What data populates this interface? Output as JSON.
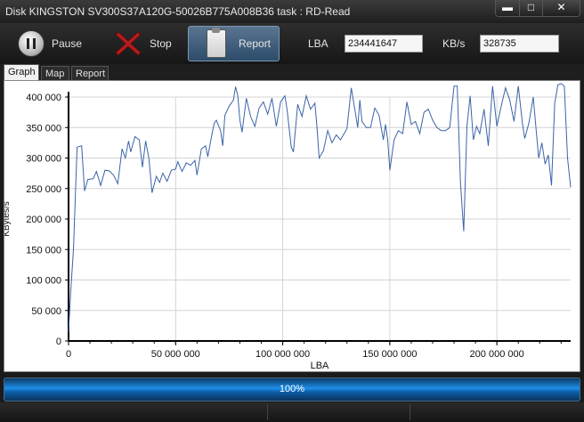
{
  "window": {
    "title": "Disk KINGSTON SV300S37A120G-50026B775A008B36   task : RD-Read",
    "minimize_glyph": "▬",
    "maximize_glyph": "□",
    "close_glyph": "✕"
  },
  "toolbar": {
    "pause_label": "Pause",
    "stop_label": "Stop",
    "report_label": "Report",
    "lba_label": "LBA",
    "lba_value": "234441647",
    "kbs_label": "KB/s",
    "kbs_value": "328735",
    "accent_color": "#3b5f82"
  },
  "tabs": [
    {
      "label": "Graph",
      "active": true
    },
    {
      "label": "Map",
      "active": false
    },
    {
      "label": "Report",
      "active": false
    }
  ],
  "chart_data": {
    "type": "line",
    "title": "",
    "xlabel": "LBA",
    "ylabel": "KBytes/s",
    "xlim": [
      0,
      234441647
    ],
    "ylim": [
      0,
      400000
    ],
    "x_ticks": [
      0,
      50000000,
      100000000,
      150000000,
      200000000
    ],
    "x_tick_labels": [
      "0",
      "50 000 000",
      "100 000 000",
      "150 000 000",
      "200 000 000"
    ],
    "y_ticks": [
      0,
      50000,
      100000,
      150000,
      200000,
      250000,
      300000,
      350000,
      400000
    ],
    "y_tick_labels": [
      "0",
      "50 000",
      "100 000",
      "150 000",
      "200 000",
      "250 000",
      "300 000",
      "350 000",
      "400 000"
    ],
    "grid": true,
    "line_color": "#3b64a8",
    "series": [
      {
        "values": [
          [
            0,
            15000
          ],
          [
            1000000,
            80000
          ],
          [
            2300000,
            150000
          ],
          [
            4000000,
            318000
          ],
          [
            6100000,
            320000
          ],
          [
            7500000,
            246000
          ],
          [
            9000000,
            265000
          ],
          [
            11500000,
            266000
          ],
          [
            13000000,
            278000
          ],
          [
            15000000,
            255000
          ],
          [
            17000000,
            280000
          ],
          [
            19000000,
            279000
          ],
          [
            21000000,
            272000
          ],
          [
            23000000,
            258000
          ],
          [
            25000000,
            315000
          ],
          [
            26500000,
            300000
          ],
          [
            28000000,
            328000
          ],
          [
            29000000,
            310000
          ],
          [
            31000000,
            335000
          ],
          [
            33000000,
            330000
          ],
          [
            34500000,
            285000
          ],
          [
            36000000,
            328000
          ],
          [
            37500000,
            300000
          ],
          [
            39000000,
            243000
          ],
          [
            41000000,
            270000
          ],
          [
            42500000,
            260000
          ],
          [
            44000000,
            275000
          ],
          [
            46000000,
            262000
          ],
          [
            48000000,
            280000
          ],
          [
            50000000,
            282000
          ],
          [
            51000000,
            294000
          ],
          [
            53000000,
            278000
          ],
          [
            55000000,
            292000
          ],
          [
            57000000,
            288000
          ],
          [
            59000000,
            296000
          ],
          [
            60000000,
            272000
          ],
          [
            62000000,
            315000
          ],
          [
            64000000,
            320000
          ],
          [
            65000000,
            302000
          ],
          [
            67000000,
            340000
          ],
          [
            68000000,
            357000
          ],
          [
            69000000,
            362000
          ],
          [
            71000000,
            345000
          ],
          [
            72000000,
            320000
          ],
          [
            73000000,
            370000
          ],
          [
            75000000,
            385000
          ],
          [
            77000000,
            395000
          ],
          [
            78000000,
            417000
          ],
          [
            79000000,
            402000
          ],
          [
            80000000,
            362000
          ],
          [
            81000000,
            342000
          ],
          [
            83000000,
            398000
          ],
          [
            85000000,
            368000
          ],
          [
            87000000,
            352000
          ],
          [
            89000000,
            382000
          ],
          [
            91000000,
            392000
          ],
          [
            93000000,
            372000
          ],
          [
            95000000,
            398000
          ],
          [
            97000000,
            352000
          ],
          [
            99000000,
            392000
          ],
          [
            101000000,
            402000
          ],
          [
            102000000,
            380000
          ],
          [
            104000000,
            318000
          ],
          [
            105000000,
            310000
          ],
          [
            107000000,
            388000
          ],
          [
            109000000,
            368000
          ],
          [
            111000000,
            402000
          ],
          [
            113000000,
            380000
          ],
          [
            115000000,
            390000
          ],
          [
            116000000,
            350000
          ],
          [
            117000000,
            300000
          ],
          [
            119000000,
            312000
          ],
          [
            121000000,
            345000
          ],
          [
            123000000,
            325000
          ],
          [
            125000000,
            338000
          ],
          [
            127000000,
            330000
          ],
          [
            130000000,
            348000
          ],
          [
            132000000,
            415000
          ],
          [
            134000000,
            372000
          ],
          [
            135000000,
            350000
          ],
          [
            136000000,
            395000
          ],
          [
            137000000,
            360000
          ],
          [
            139000000,
            350000
          ],
          [
            141000000,
            350000
          ],
          [
            143000000,
            382000
          ],
          [
            145000000,
            370000
          ],
          [
            147000000,
            330000
          ],
          [
            148000000,
            355000
          ],
          [
            149000000,
            330000
          ],
          [
            150000000,
            280000
          ],
          [
            152000000,
            330000
          ],
          [
            154000000,
            345000
          ],
          [
            156000000,
            340000
          ],
          [
            158000000,
            392000
          ],
          [
            160000000,
            355000
          ],
          [
            162000000,
            360000
          ],
          [
            164000000,
            340000
          ],
          [
            166000000,
            375000
          ],
          [
            168000000,
            380000
          ],
          [
            170000000,
            362000
          ],
          [
            172000000,
            350000
          ],
          [
            174000000,
            345000
          ],
          [
            176000000,
            345000
          ],
          [
            178000000,
            350000
          ],
          [
            180000000,
            418000
          ],
          [
            181500000,
            418000
          ],
          [
            183000000,
            260000
          ],
          [
            184500000,
            180000
          ],
          [
            186000000,
            352000
          ],
          [
            187500000,
            402000
          ],
          [
            189000000,
            330000
          ],
          [
            190500000,
            352000
          ],
          [
            192000000,
            340000
          ],
          [
            194000000,
            380000
          ],
          [
            196000000,
            320000
          ],
          [
            198000000,
            418000
          ],
          [
            200000000,
            352000
          ],
          [
            202000000,
            385000
          ],
          [
            204000000,
            415000
          ],
          [
            206000000,
            395000
          ],
          [
            208000000,
            360000
          ],
          [
            210000000,
            418000
          ],
          [
            212000000,
            355000
          ],
          [
            213000000,
            332000
          ],
          [
            215000000,
            358000
          ],
          [
            217000000,
            400000
          ],
          [
            218000000,
            360000
          ],
          [
            219500000,
            300000
          ],
          [
            221000000,
            325000
          ],
          [
            222500000,
            290000
          ],
          [
            224000000,
            305000
          ],
          [
            225500000,
            255000
          ],
          [
            227000000,
            390000
          ],
          [
            228500000,
            420000
          ],
          [
            230000000,
            422000
          ],
          [
            231500000,
            418000
          ],
          [
            233000000,
            300000
          ],
          [
            234441647,
            252000
          ]
        ]
      }
    ]
  },
  "progress": {
    "text": "100%",
    "fraction": 1.0
  }
}
